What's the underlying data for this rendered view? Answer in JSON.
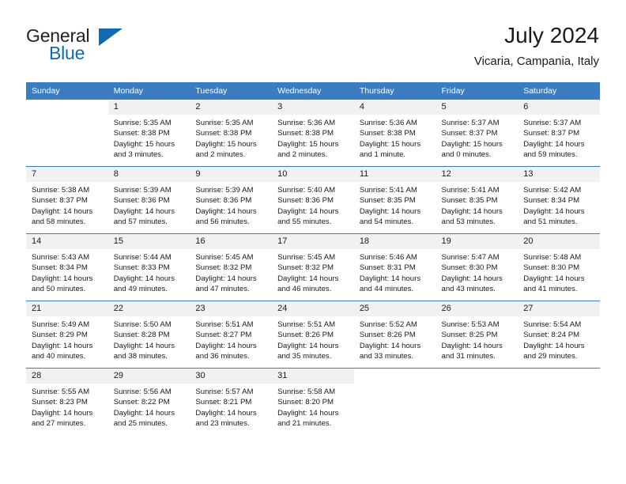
{
  "brand": {
    "name_part1": "General",
    "name_part2": "Blue",
    "accent_color": "#1269b0",
    "triangle_icon": "triangle-icon"
  },
  "header": {
    "title": "July 2024",
    "subtitle": "Vicaria, Campania, Italy"
  },
  "calendar": {
    "header_bg": "#3b7dc0",
    "daynum_bg": "#f1f1f1",
    "weekday_headers": [
      "Sunday",
      "Monday",
      "Tuesday",
      "Wednesday",
      "Thursday",
      "Friday",
      "Saturday"
    ],
    "weeks": [
      [
        {
          "day": "",
          "sunrise": "",
          "sunset": "",
          "daylight_line1": "",
          "daylight_line2": ""
        },
        {
          "day": "1",
          "sunrise": "Sunrise: 5:35 AM",
          "sunset": "Sunset: 8:38 PM",
          "daylight_line1": "Daylight: 15 hours",
          "daylight_line2": "and 3 minutes."
        },
        {
          "day": "2",
          "sunrise": "Sunrise: 5:35 AM",
          "sunset": "Sunset: 8:38 PM",
          "daylight_line1": "Daylight: 15 hours",
          "daylight_line2": "and 2 minutes."
        },
        {
          "day": "3",
          "sunrise": "Sunrise: 5:36 AM",
          "sunset": "Sunset: 8:38 PM",
          "daylight_line1": "Daylight: 15 hours",
          "daylight_line2": "and 2 minutes."
        },
        {
          "day": "4",
          "sunrise": "Sunrise: 5:36 AM",
          "sunset": "Sunset: 8:38 PM",
          "daylight_line1": "Daylight: 15 hours",
          "daylight_line2": "and 1 minute."
        },
        {
          "day": "5",
          "sunrise": "Sunrise: 5:37 AM",
          "sunset": "Sunset: 8:37 PM",
          "daylight_line1": "Daylight: 15 hours",
          "daylight_line2": "and 0 minutes."
        },
        {
          "day": "6",
          "sunrise": "Sunrise: 5:37 AM",
          "sunset": "Sunset: 8:37 PM",
          "daylight_line1": "Daylight: 14 hours",
          "daylight_line2": "and 59 minutes."
        }
      ],
      [
        {
          "day": "7",
          "sunrise": "Sunrise: 5:38 AM",
          "sunset": "Sunset: 8:37 PM",
          "daylight_line1": "Daylight: 14 hours",
          "daylight_line2": "and 58 minutes."
        },
        {
          "day": "8",
          "sunrise": "Sunrise: 5:39 AM",
          "sunset": "Sunset: 8:36 PM",
          "daylight_line1": "Daylight: 14 hours",
          "daylight_line2": "and 57 minutes."
        },
        {
          "day": "9",
          "sunrise": "Sunrise: 5:39 AM",
          "sunset": "Sunset: 8:36 PM",
          "daylight_line1": "Daylight: 14 hours",
          "daylight_line2": "and 56 minutes."
        },
        {
          "day": "10",
          "sunrise": "Sunrise: 5:40 AM",
          "sunset": "Sunset: 8:36 PM",
          "daylight_line1": "Daylight: 14 hours",
          "daylight_line2": "and 55 minutes."
        },
        {
          "day": "11",
          "sunrise": "Sunrise: 5:41 AM",
          "sunset": "Sunset: 8:35 PM",
          "daylight_line1": "Daylight: 14 hours",
          "daylight_line2": "and 54 minutes."
        },
        {
          "day": "12",
          "sunrise": "Sunrise: 5:41 AM",
          "sunset": "Sunset: 8:35 PM",
          "daylight_line1": "Daylight: 14 hours",
          "daylight_line2": "and 53 minutes."
        },
        {
          "day": "13",
          "sunrise": "Sunrise: 5:42 AM",
          "sunset": "Sunset: 8:34 PM",
          "daylight_line1": "Daylight: 14 hours",
          "daylight_line2": "and 51 minutes."
        }
      ],
      [
        {
          "day": "14",
          "sunrise": "Sunrise: 5:43 AM",
          "sunset": "Sunset: 8:34 PM",
          "daylight_line1": "Daylight: 14 hours",
          "daylight_line2": "and 50 minutes."
        },
        {
          "day": "15",
          "sunrise": "Sunrise: 5:44 AM",
          "sunset": "Sunset: 8:33 PM",
          "daylight_line1": "Daylight: 14 hours",
          "daylight_line2": "and 49 minutes."
        },
        {
          "day": "16",
          "sunrise": "Sunrise: 5:45 AM",
          "sunset": "Sunset: 8:32 PM",
          "daylight_line1": "Daylight: 14 hours",
          "daylight_line2": "and 47 minutes."
        },
        {
          "day": "17",
          "sunrise": "Sunrise: 5:45 AM",
          "sunset": "Sunset: 8:32 PM",
          "daylight_line1": "Daylight: 14 hours",
          "daylight_line2": "and 46 minutes."
        },
        {
          "day": "18",
          "sunrise": "Sunrise: 5:46 AM",
          "sunset": "Sunset: 8:31 PM",
          "daylight_line1": "Daylight: 14 hours",
          "daylight_line2": "and 44 minutes."
        },
        {
          "day": "19",
          "sunrise": "Sunrise: 5:47 AM",
          "sunset": "Sunset: 8:30 PM",
          "daylight_line1": "Daylight: 14 hours",
          "daylight_line2": "and 43 minutes."
        },
        {
          "day": "20",
          "sunrise": "Sunrise: 5:48 AM",
          "sunset": "Sunset: 8:30 PM",
          "daylight_line1": "Daylight: 14 hours",
          "daylight_line2": "and 41 minutes."
        }
      ],
      [
        {
          "day": "21",
          "sunrise": "Sunrise: 5:49 AM",
          "sunset": "Sunset: 8:29 PM",
          "daylight_line1": "Daylight: 14 hours",
          "daylight_line2": "and 40 minutes."
        },
        {
          "day": "22",
          "sunrise": "Sunrise: 5:50 AM",
          "sunset": "Sunset: 8:28 PM",
          "daylight_line1": "Daylight: 14 hours",
          "daylight_line2": "and 38 minutes."
        },
        {
          "day": "23",
          "sunrise": "Sunrise: 5:51 AM",
          "sunset": "Sunset: 8:27 PM",
          "daylight_line1": "Daylight: 14 hours",
          "daylight_line2": "and 36 minutes."
        },
        {
          "day": "24",
          "sunrise": "Sunrise: 5:51 AM",
          "sunset": "Sunset: 8:26 PM",
          "daylight_line1": "Daylight: 14 hours",
          "daylight_line2": "and 35 minutes."
        },
        {
          "day": "25",
          "sunrise": "Sunrise: 5:52 AM",
          "sunset": "Sunset: 8:26 PM",
          "daylight_line1": "Daylight: 14 hours",
          "daylight_line2": "and 33 minutes."
        },
        {
          "day": "26",
          "sunrise": "Sunrise: 5:53 AM",
          "sunset": "Sunset: 8:25 PM",
          "daylight_line1": "Daylight: 14 hours",
          "daylight_line2": "and 31 minutes."
        },
        {
          "day": "27",
          "sunrise": "Sunrise: 5:54 AM",
          "sunset": "Sunset: 8:24 PM",
          "daylight_line1": "Daylight: 14 hours",
          "daylight_line2": "and 29 minutes."
        }
      ],
      [
        {
          "day": "28",
          "sunrise": "Sunrise: 5:55 AM",
          "sunset": "Sunset: 8:23 PM",
          "daylight_line1": "Daylight: 14 hours",
          "daylight_line2": "and 27 minutes."
        },
        {
          "day": "29",
          "sunrise": "Sunrise: 5:56 AM",
          "sunset": "Sunset: 8:22 PM",
          "daylight_line1": "Daylight: 14 hours",
          "daylight_line2": "and 25 minutes."
        },
        {
          "day": "30",
          "sunrise": "Sunrise: 5:57 AM",
          "sunset": "Sunset: 8:21 PM",
          "daylight_line1": "Daylight: 14 hours",
          "daylight_line2": "and 23 minutes."
        },
        {
          "day": "31",
          "sunrise": "Sunrise: 5:58 AM",
          "sunset": "Sunset: 8:20 PM",
          "daylight_line1": "Daylight: 14 hours",
          "daylight_line2": "and 21 minutes."
        },
        {
          "day": "",
          "sunrise": "",
          "sunset": "",
          "daylight_line1": "",
          "daylight_line2": ""
        },
        {
          "day": "",
          "sunrise": "",
          "sunset": "",
          "daylight_line1": "",
          "daylight_line2": ""
        },
        {
          "day": "",
          "sunrise": "",
          "sunset": "",
          "daylight_line1": "",
          "daylight_line2": ""
        }
      ]
    ]
  }
}
